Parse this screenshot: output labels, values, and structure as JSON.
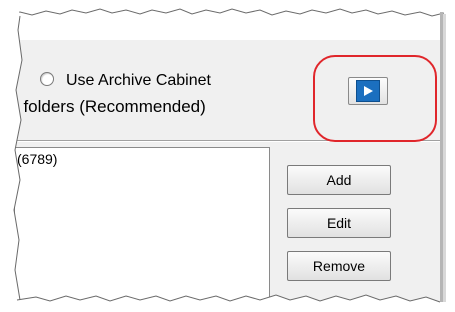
{
  "options": {
    "archive_cabinet_label": "Use Archive Cabinet",
    "folders_label": "t folders (Recommended)"
  },
  "list": {
    "items": [
      "(6789)"
    ]
  },
  "buttons": {
    "add": "Add",
    "edit": "Edit",
    "remove": "Remove"
  },
  "icons": {
    "run": "play-icon"
  },
  "colors": {
    "highlight": "#e0262b",
    "play_blue": "#1b6fbf"
  }
}
